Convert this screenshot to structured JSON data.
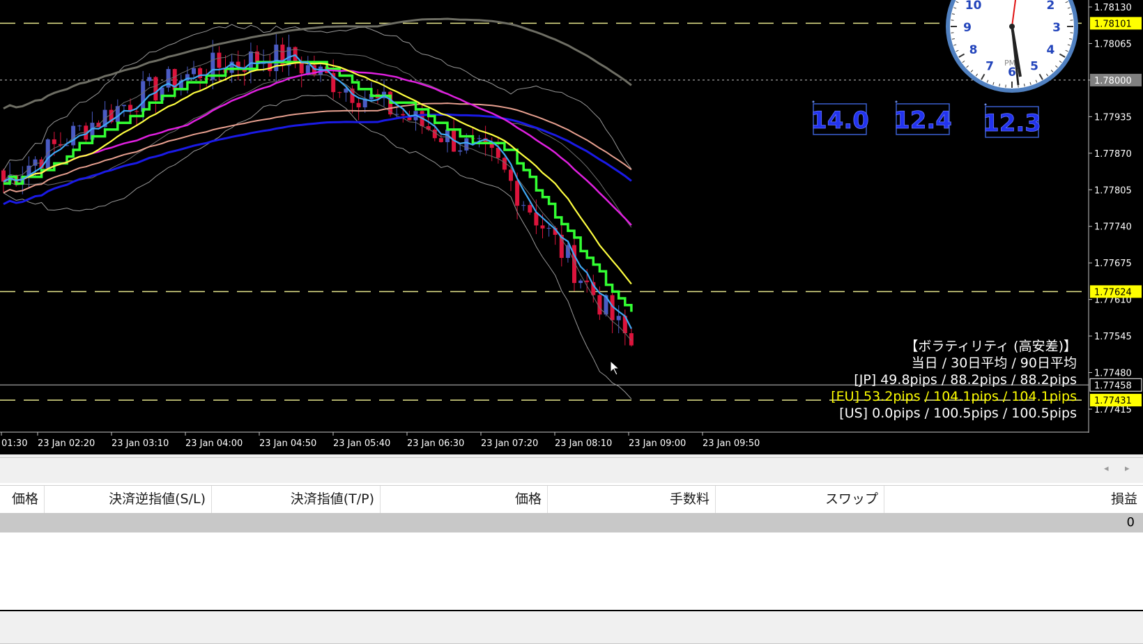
{
  "colors": {
    "background": "#000000",
    "bull_candle": "#4a5bc4",
    "bear_candle": "#dc143c",
    "ma_fast": "#3fa9f5",
    "ma_mid": "#ffff40",
    "ma_slow": "#e020e0",
    "ma_step": "#32ff32",
    "ma_blue": "#1a1ae6",
    "ma_salmon": "#e8a090",
    "ma_gray": "#6e6e64",
    "band_lines": "#9a9a9a",
    "dashed_levels": "#e6e68c",
    "accent_yellow": "#ffff00"
  },
  "chart": {
    "price_labels": [
      "1.78130",
      "1.78065",
      "1.78000",
      "1.77935",
      "1.77870",
      "1.77805",
      "1.77740",
      "1.77675",
      "1.77610",
      "1.77545",
      "1.77480",
      "1.77415"
    ],
    "highlighted_prices": [
      {
        "label": "1.78101",
        "style": "yellow"
      },
      {
        "label": "1.77624",
        "style": "yellow"
      },
      {
        "label": "1.77458",
        "style": "dark"
      },
      {
        "label": "1.77431",
        "style": "yellow"
      },
      {
        "label": "1.78000",
        "style": "gray"
      }
    ],
    "time_labels": [
      "01:30",
      "23 Jan 02:20",
      "23 Jan 03:10",
      "23 Jan 04:00",
      "23 Jan 04:50",
      "23 Jan 05:40",
      "23 Jan 06:30",
      "23 Jan 07:20",
      "23 Jan 08:10",
      "23 Jan 09:00",
      "23 Jan 09:50"
    ]
  },
  "spread_boxes": [
    "14.0",
    "12.4",
    "12.3"
  ],
  "clock": {
    "numerals": [
      "10",
      "2",
      "9",
      "3",
      "8",
      "4",
      "7",
      "5",
      "6"
    ],
    "meridiem": "PM"
  },
  "volatility": {
    "title": "【ボラティリティ (高安差)】",
    "header": "当日 / 30日平均 / 90日平均",
    "jp": "[JP] 49.8pips / 88.2pips / 88.2pips",
    "eu": "[EU] 53.2pips / 104.1pips / 104.1pips",
    "us": "[US] 0.0pips / 100.5pips / 100.5pips"
  },
  "scrollbar": {
    "left_arrow": "◂",
    "right_arrow": "▸"
  },
  "terminal": {
    "columns": [
      "価格",
      "決済逆指値(S/L)",
      "決済指値(T/P)",
      "価格",
      "手数料",
      "スワップ",
      "損益"
    ],
    "total_profit": "0"
  }
}
